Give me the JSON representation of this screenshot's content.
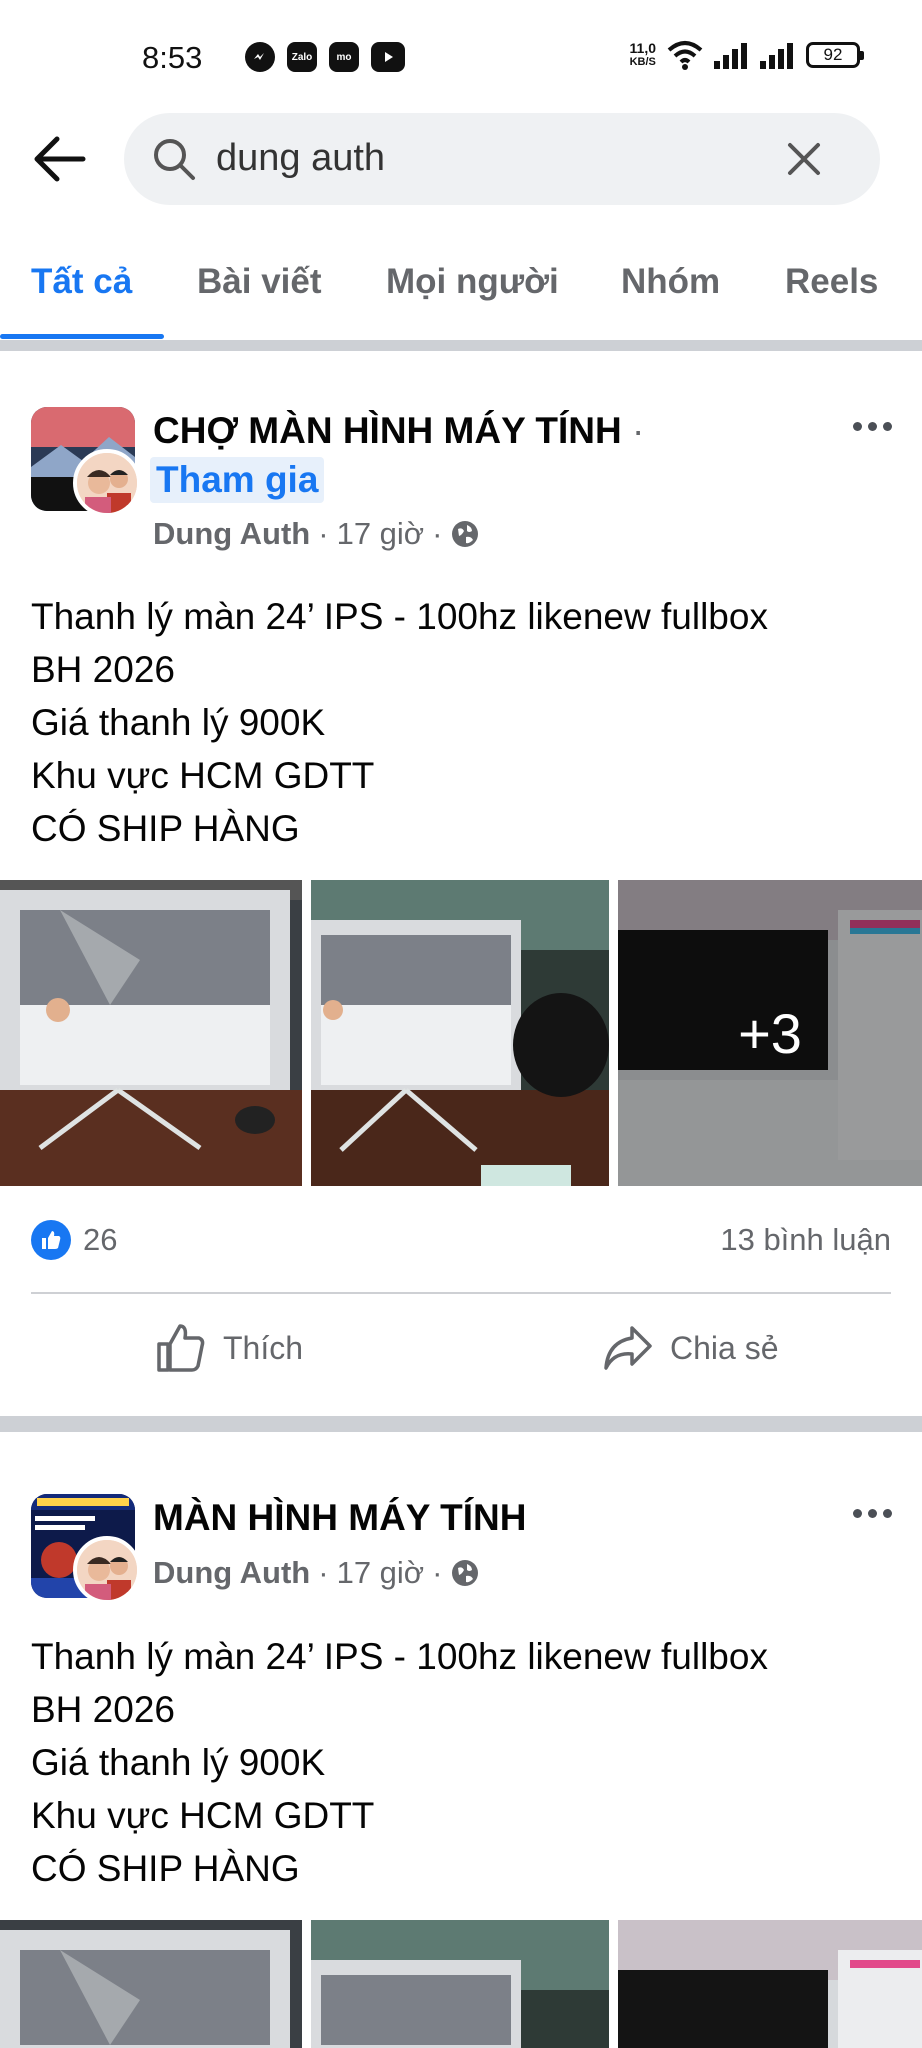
{
  "status_bar": {
    "time": "8:53",
    "apps": [
      "Messenger",
      "Zalo",
      "MoMo",
      "YouTube"
    ],
    "speed_top": "11,0",
    "speed_bottom": "KB/S",
    "battery": "92"
  },
  "search": {
    "query": "dung auth"
  },
  "tabs": [
    {
      "label": "Tất cả",
      "active": true
    },
    {
      "label": "Bài viết",
      "active": false
    },
    {
      "label": "Mọi người",
      "active": false
    },
    {
      "label": "Nhóm",
      "active": false
    },
    {
      "label": "Reels",
      "active": false
    }
  ],
  "posts": [
    {
      "group": "CHỢ MÀN HÌNH MÁY TÍNH",
      "separator": "·",
      "join_label": "Tham gia",
      "author": "Dung Auth",
      "time": "17 giờ",
      "lines": [
        "Thanh lý màn 24’ IPS - 100hz likenew fullbox",
        "BH 2026",
        "Giá thanh lý 900K",
        "Khu vực HCM GDTT",
        "CÓ SHIP HÀNG"
      ],
      "extra_photos": "+3",
      "likes": "26",
      "comments": "13 bình luận",
      "like_label": "Thích",
      "share_label": "Chia sẻ"
    },
    {
      "group": "MÀN HÌNH MÁY TÍNH",
      "author": "Dung Auth",
      "time": "17 giờ",
      "lines": [
        "Thanh lý màn 24’ IPS - 100hz likenew fullbox",
        "BH 2026",
        "Giá thanh lý 900K",
        "Khu vực HCM GDTT",
        "CÓ SHIP HÀNG"
      ]
    }
  ],
  "colors": {
    "accent": "#1877f2",
    "secondary_text": "#65676b",
    "search_bg": "#eff1f3",
    "divider": "#cdd0d5"
  }
}
